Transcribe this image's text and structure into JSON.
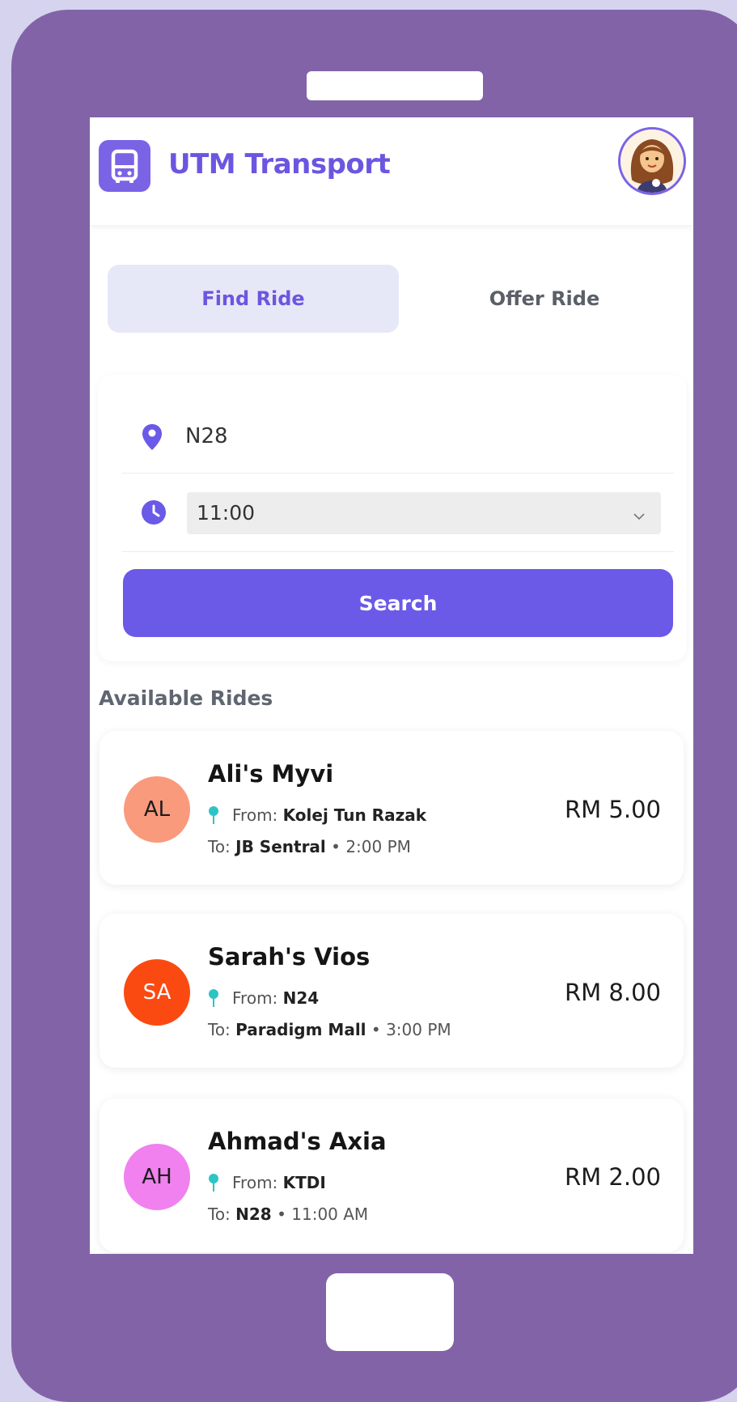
{
  "app": {
    "title": "UTM Transport"
  },
  "tabs": [
    {
      "label": "Find Ride",
      "active": true
    },
    {
      "label": "Offer Ride",
      "active": false
    }
  ],
  "search": {
    "location_value": "N28",
    "time_value": "11:00",
    "button_label": "Search"
  },
  "rides_section": {
    "title": "Available Rides"
  },
  "rides": [
    {
      "initials": "AL",
      "avatar_color": "#fa9a7c",
      "name": "Ali's Myvi",
      "from_label": "From:",
      "from": "Kolej Tun Razak",
      "to_label": "To:",
      "to": "JB Sentral",
      "separator": "•",
      "time": "2:00 PM",
      "price": "RM 5.00"
    },
    {
      "initials": "SA",
      "avatar_color": "#fa4a12",
      "name": "Sarah's Vios",
      "from_label": "From:",
      "from": "N24",
      "to_label": "To:",
      "to": "Paradigm Mall",
      "separator": "•",
      "time": "3:00 PM",
      "price": "RM 8.00"
    },
    {
      "initials": "AH",
      "avatar_color": "#f081ef",
      "name": "Ahmad's Axia",
      "from_label": "From:",
      "from": "KTDI",
      "to_label": "To:",
      "to": "N28",
      "separator": "•",
      "time": "11:00 AM",
      "price": "RM 2.00"
    }
  ],
  "colors": {
    "accent": "#6b59e8",
    "title": "#6b56e0",
    "pin": "#2ec4c4",
    "phone_frame": "#8263a8",
    "background": "#d6d3ee"
  },
  "icons": {
    "logo": "bus-icon",
    "location": "location-pin-icon",
    "time": "clock-icon",
    "select": "chevron-down-icon",
    "ride_from": "map-pin-icon"
  }
}
